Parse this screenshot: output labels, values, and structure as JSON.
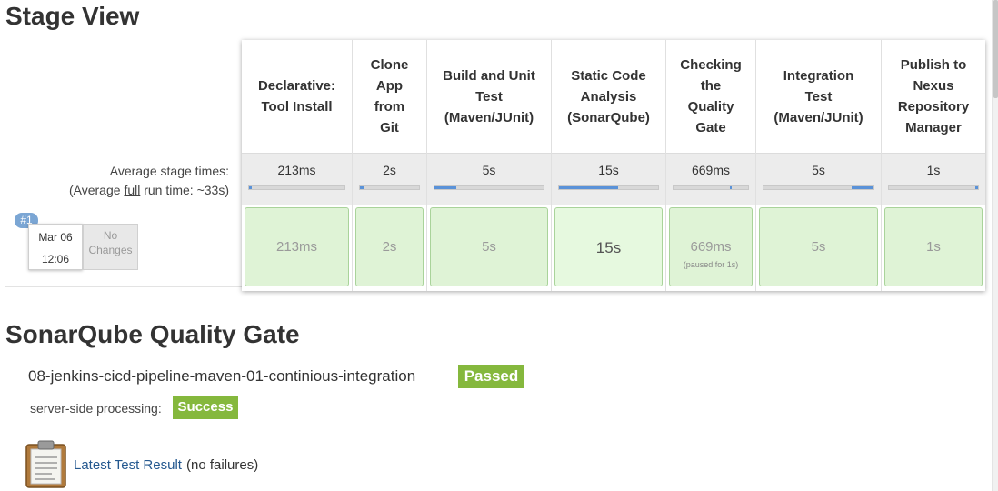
{
  "stage_view": {
    "title": "Stage View",
    "avg_label": "Average stage times:",
    "avg_full_prefix": "(Average ",
    "avg_full_link": "full",
    "avg_full_suffix": " run time: ~33s)",
    "stages": [
      {
        "name_lines": [
          "Declarative:",
          "Tool Install"
        ],
        "avg": "213ms",
        "avg_fraction": 0.0,
        "run_time": "213ms"
      },
      {
        "name_lines": [
          "Clone",
          "App",
          "from",
          "Git"
        ],
        "avg": "2s",
        "avg_fraction": 0.06,
        "run_time": "2s"
      },
      {
        "name_lines": [
          "Build and Unit",
          "Test",
          "(Maven/JUnit)"
        ],
        "avg": "5s",
        "avg_fraction": 0.2,
        "run_time": "5s"
      },
      {
        "name_lines": [
          "Static Code",
          "Analysis",
          "(SonarQube)"
        ],
        "avg": "15s",
        "avg_fraction": 0.6,
        "run_time": "15s"
      },
      {
        "name_lines": [
          "Checking",
          "the",
          "Quality",
          "Gate"
        ],
        "avg": "669ms",
        "avg_fraction": 0.03,
        "run_time": "669ms",
        "run_note": "(paused for 1s)"
      },
      {
        "name_lines": [
          "Integration",
          "Test",
          "(Maven/JUnit)"
        ],
        "avg": "5s",
        "avg_fraction": 0.2,
        "run_time": "5s"
      },
      {
        "name_lines": [
          "Publish to",
          "Nexus",
          "Repository",
          "Manager"
        ],
        "avg": "1s",
        "avg_fraction": 0.03,
        "run_time": "1s"
      }
    ],
    "build": {
      "badge": "#1",
      "date": "Mar 06",
      "time": "12:06",
      "changes": "No Changes"
    }
  },
  "sonar": {
    "title": "SonarQube Quality Gate",
    "project": "08-jenkins-cicd-pipeline-maven-01-continious-integration",
    "status": "Passed",
    "processing_label": "server-side processing:",
    "processing_status": "Success"
  },
  "test_result": {
    "icon": "clipboard-icon",
    "link": "Latest Test Result",
    "note": "(no failures)"
  },
  "colors": {
    "success_green": "#85b83d",
    "stage_cell_green": "#dff3d6",
    "link_blue": "#24588f",
    "bar_blue": "#5a92d8"
  }
}
